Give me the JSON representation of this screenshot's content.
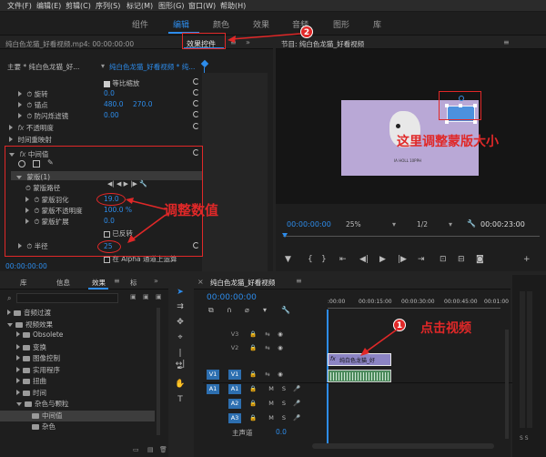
{
  "menu": [
    "文件(F)",
    "编辑(E)",
    "剪辑(C)",
    "序列(S)",
    "标记(M)",
    "图形(G)",
    "窗口(W)",
    "帮助(H)"
  ],
  "workspaces": [
    "组件",
    "编辑",
    "颜色",
    "效果",
    "音频",
    "图形",
    "库"
  ],
  "effect_controls": {
    "source_tab": "纯白色龙猫_好看视频.mp4: 00:00:00:00",
    "active_tab": "效果控件",
    "master_label": "主要 * 纯白色龙猫_好...",
    "sequence_label": "纯白色龙猫_好看视频 * 纯...",
    "uniform_scale": "等比缩放",
    "rotation": {
      "label": "旋转",
      "value": "0.0"
    },
    "anchor": {
      "label": "锚点",
      "x": "480.0",
      "y": "270.0"
    },
    "antiflicker": {
      "label": "防闪烁滤镜",
      "value": "0.00"
    },
    "opacity": "不透明度",
    "time_remap": "时间重映射",
    "fx_name": "中间值",
    "mask_name": "蒙版(1)",
    "mask_path": "蒙版路径",
    "mask_feather": {
      "label": "蒙版羽化",
      "value": "19.0"
    },
    "mask_opacity": {
      "label": "蒙版不透明度",
      "value": "100.0 %"
    },
    "mask_expansion": {
      "label": "蒙版扩展",
      "value": "0.0"
    },
    "inverted": "已反转",
    "radius": {
      "label": "半径",
      "value": "25"
    },
    "alpha_label": "在 Alpha 通道上运算",
    "timecode": "00:00:00:00"
  },
  "program": {
    "title": "节目: 纯白色龙猫_好看视频",
    "timecode": "00:00:00:00",
    "zoom": "25%",
    "resolution": "1/2",
    "duration": "00:00:23:00",
    "video_caption": "IA HOLL 10PPH"
  },
  "project": {
    "tabs": [
      "库",
      "信息",
      "效果",
      "标"
    ],
    "tree": [
      {
        "label": "音频过渡",
        "expanded": false,
        "depth": 0
      },
      {
        "label": "视频效果",
        "expanded": true,
        "depth": 0
      },
      {
        "label": "Obsolete",
        "expanded": false,
        "depth": 1
      },
      {
        "label": "变换",
        "expanded": false,
        "depth": 1
      },
      {
        "label": "图像控制",
        "expanded": false,
        "depth": 1
      },
      {
        "label": "实用程序",
        "expanded": false,
        "depth": 1
      },
      {
        "label": "扭曲",
        "expanded": false,
        "depth": 1
      },
      {
        "label": "时间",
        "expanded": false,
        "depth": 1
      },
      {
        "label": "杂色与颗粒",
        "expanded": true,
        "depth": 1
      },
      {
        "label": "中间值",
        "expanded": false,
        "depth": 2,
        "selected": true
      },
      {
        "label": "杂色",
        "expanded": false,
        "depth": 2
      }
    ]
  },
  "timeline": {
    "title": "纯白色龙猫_好看视频",
    "timecode": "00:00:00:00",
    "ruler": [
      ":00:00",
      "00:00:15:00",
      "00:00:30:00",
      "00:00:45:00",
      "00:01:00"
    ],
    "video_tracks": [
      "V3",
      "V2",
      "V1"
    ],
    "audio_tracks": [
      "A1",
      "A2",
      "A3"
    ],
    "master": {
      "label": "主声道",
      "value": "0.0"
    },
    "clip_label": "纯白色龙猫_好"
  },
  "annotations": {
    "adjust_mask_size": "这里调整蒙版大小",
    "adjust_values": "调整数值",
    "click_video": "点击视频",
    "badge1": "1",
    "badge2": "2"
  },
  "colors": {
    "accent": "#2d8ceb",
    "annotation": "#e02828",
    "video_bg": "#b9a8d6",
    "clip": "#8c84c4"
  }
}
